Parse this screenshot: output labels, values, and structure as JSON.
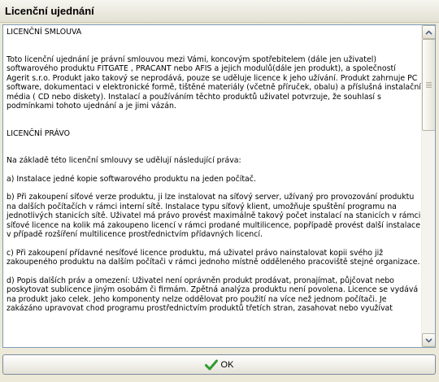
{
  "window": {
    "title": "Licenční ujednání"
  },
  "license": {
    "paragraphs": [
      "LICENČNÍ SMLOUVA",
      "Toto licenční ujednání je právní smlouvou mezi Vámi, koncovým spotřebitelem (dále jen uživatel) softwarového produktu FITGATE , PRACANT nebo AFIS a jejich modulů(dále jen produkt), a společností Agerit s.r.o. Produkt jako takový se neprodává, pouze se uděluje licence k jeho užívání. Produkt zahrnuje PC software, dokumentaci v elektronické formě, tištěné materiály (včetně příruček, obalu) a příslušná instalační média ( CD nebo diskety). Instalací a používáním těchto produktů uživatel potvrzuje, že souhlasí s podmínkami tohoto ujednání a je jimi vázán.",
      "LICENČNÍ PRÁVO",
      "Na základě této licenční smlouvy se udělují následující práva:",
      "a) Instalace jedné kopie softwarového produktu na jeden počítač.",
      "b) Při zakoupení síťové verze produktu, ji lze instalovat na síťový server, užívaný pro provozování produktu na dalších počítačích v rámci interní sítě. Instalace typu síťový klient, umožňuje spuštění programu na jednotlivých stanicích sítě. Uživatel má právo provést maximálně takový počet instalací na stanicích v rámci síťové licence na kolik má zakoupeno licencí v rámci prodané multilicence, popřípadě provést další instalace v případě rozšíření multilicence prostřednictvím přídavných licencí.",
      "c) Při zakoupení přídavné nesíťové licence produktu, má uživatel právo nainstalovat kopii svého již zakoupeného produktu na dalším počítači v rámci jednoho místně odděleného pracoviště stejné organizace.",
      "d) Popis dalších práv a omezení: Uživatel není oprávněn produkt prodávat, pronajímat, půjčovat nebo poskytovat sublicence jiným osobám či firmám. Zpětná analýza produktu není povolena. Licence se vydává na produkt jako celek. Jeho komponenty nelze oddělovat pro použití na více než jednom počítači. Je zakázáno upravovat chod programu prostřednictvím produktů třetích stran, zasahovat nebo využívat"
    ]
  },
  "footer": {
    "ok_label": "OK"
  },
  "icons": {
    "ok": "checkmark-icon",
    "scroll_up": "arrow-up-icon",
    "scroll_down": "arrow-down-icon"
  },
  "colors": {
    "checkmark": "#2e9b2e",
    "arrow": "#4d6185"
  }
}
